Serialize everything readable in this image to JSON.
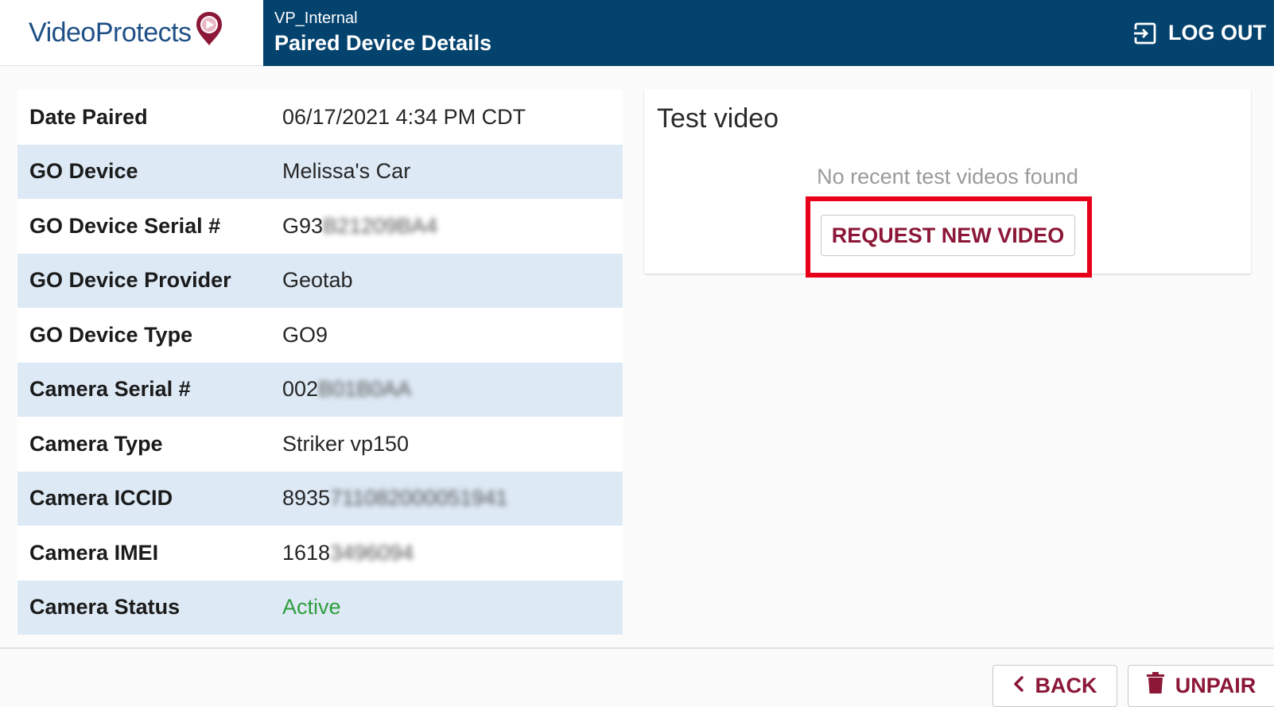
{
  "header": {
    "brand": "VideoProtects",
    "org_name": "VP_Internal",
    "page_title": "Paired Device Details",
    "logout_label": "LOG OUT"
  },
  "details": [
    {
      "label": "Date Paired",
      "value": "06/17/2021 4:34 PM CDT",
      "blurred": ""
    },
    {
      "label": "GO Device",
      "value": "Melissa's Car",
      "blurred": ""
    },
    {
      "label": "GO Device Serial #",
      "value": "G93",
      "blurred": "B21209BA4"
    },
    {
      "label": "GO Device Provider",
      "value": "Geotab",
      "blurred": ""
    },
    {
      "label": "GO Device Type",
      "value": "GO9",
      "blurred": ""
    },
    {
      "label": "Camera Serial #",
      "value": "002",
      "blurred": "B01B0AA"
    },
    {
      "label": "Camera Type",
      "value": "Striker vp150",
      "blurred": ""
    },
    {
      "label": "Camera ICCID",
      "value": "8935",
      "blurred": "711082000051941"
    },
    {
      "label": "Camera IMEI",
      "value": "1618",
      "blurred": "3496094"
    },
    {
      "label": "Camera Status",
      "value": "Active",
      "blurred": "",
      "status": "active"
    }
  ],
  "test_video": {
    "title": "Test video",
    "empty_message": "No recent test videos found",
    "request_label": "REQUEST NEW VIDEO"
  },
  "footer": {
    "back_label": "BACK",
    "unpair_label": "UNPAIR"
  },
  "colors": {
    "header_bg": "#05436f",
    "brand_text": "#1e4f86",
    "accent": "#8c1737",
    "row_alt": "#dde9f5",
    "active_status": "#2e9e3e",
    "highlight": "#e8001a"
  }
}
